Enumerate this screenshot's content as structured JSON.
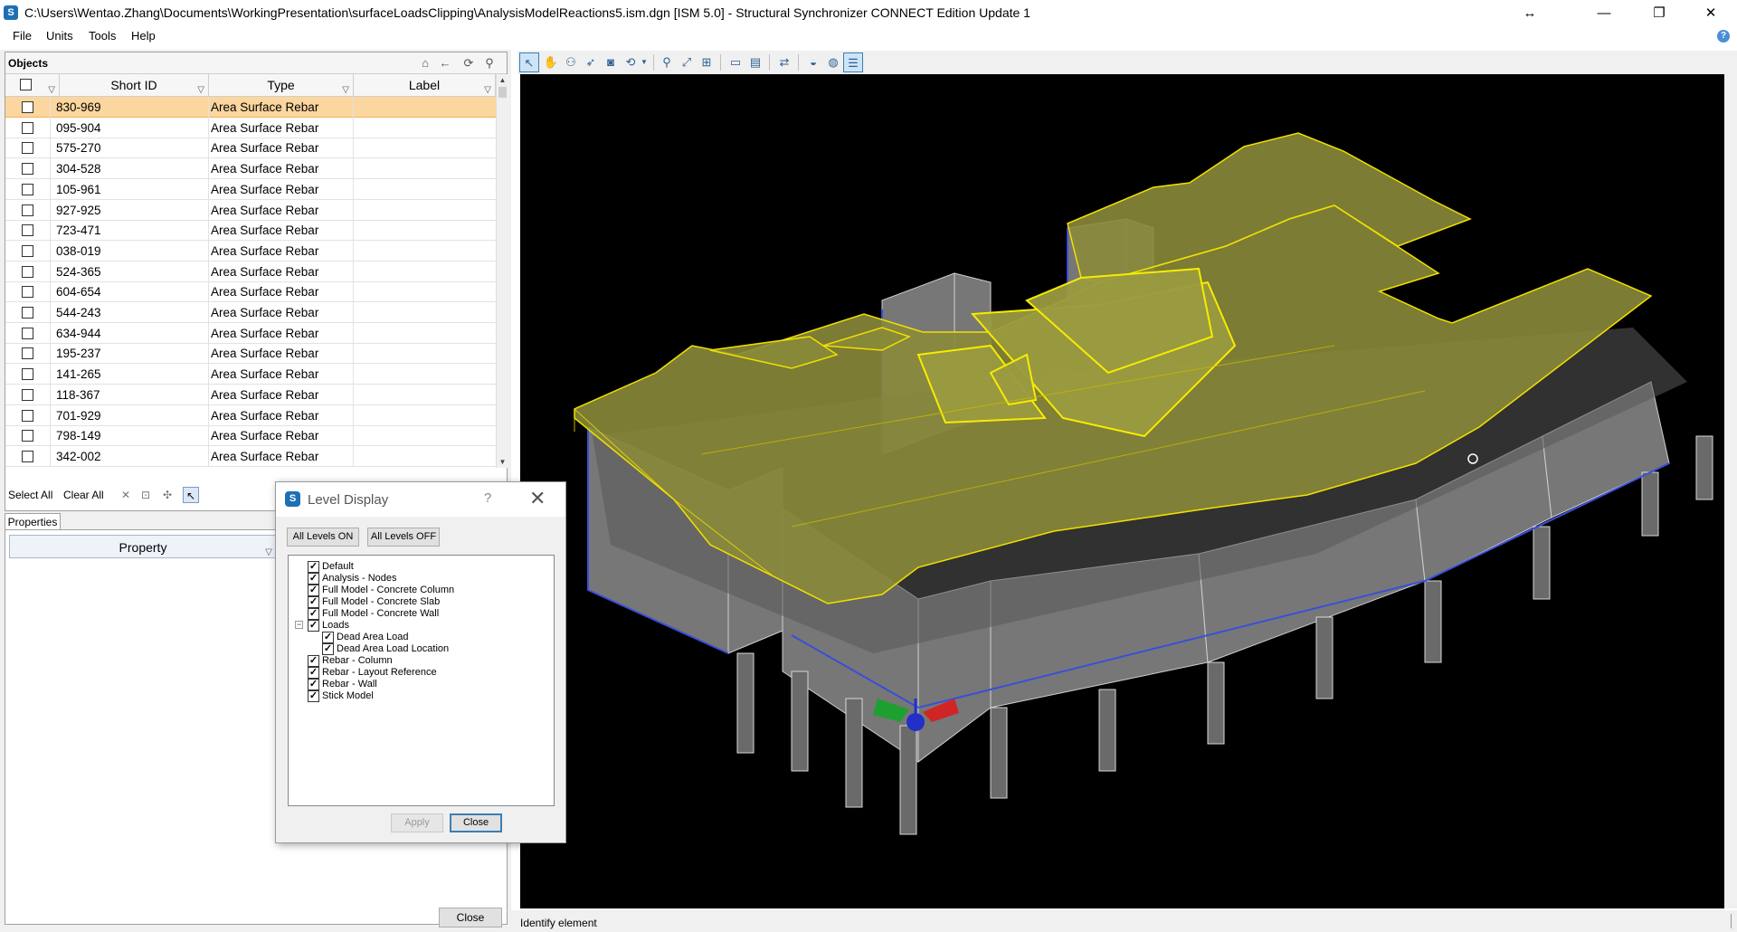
{
  "window": {
    "title": "C:\\Users\\Wentao.Zhang\\Documents\\WorkingPresentation\\surfaceLoadsClipping\\AnalysisModelReactions5.ism.dgn [ISM 5.0] - Structural Synchronizer CONNECT Edition Update 1",
    "icon": "S",
    "resize_glyph": "↔",
    "minimize_glyph": "—",
    "restore_glyph": "❐",
    "close_glyph": "✕"
  },
  "menu": {
    "file": "File",
    "units": "Units",
    "tools": "Tools",
    "help": "Help",
    "help_icon": "?"
  },
  "objects_panel": {
    "title": "Objects",
    "columns": {
      "short_id": "Short ID",
      "type": "Type",
      "label": "Label"
    },
    "rows": [
      {
        "id": "830-969",
        "type": "Area Surface Rebar",
        "label": ""
      },
      {
        "id": "095-904",
        "type": "Area Surface Rebar",
        "label": ""
      },
      {
        "id": "575-270",
        "type": "Area Surface Rebar",
        "label": ""
      },
      {
        "id": "304-528",
        "type": "Area Surface Rebar",
        "label": ""
      },
      {
        "id": "105-961",
        "type": "Area Surface Rebar",
        "label": ""
      },
      {
        "id": "927-925",
        "type": "Area Surface Rebar",
        "label": ""
      },
      {
        "id": "723-471",
        "type": "Area Surface Rebar",
        "label": ""
      },
      {
        "id": "038-019",
        "type": "Area Surface Rebar",
        "label": ""
      },
      {
        "id": "524-365",
        "type": "Area Surface Rebar",
        "label": ""
      },
      {
        "id": "604-654",
        "type": "Area Surface Rebar",
        "label": ""
      },
      {
        "id": "544-243",
        "type": "Area Surface Rebar",
        "label": ""
      },
      {
        "id": "634-944",
        "type": "Area Surface Rebar",
        "label": ""
      },
      {
        "id": "195-237",
        "type": "Area Surface Rebar",
        "label": ""
      },
      {
        "id": "141-265",
        "type": "Area Surface Rebar",
        "label": ""
      },
      {
        "id": "118-367",
        "type": "Area Surface Rebar",
        "label": ""
      },
      {
        "id": "701-929",
        "type": "Area Surface Rebar",
        "label": ""
      },
      {
        "id": "798-149",
        "type": "Area Surface Rebar",
        "label": ""
      },
      {
        "id": "342-002",
        "type": "Area Surface Rebar",
        "label": ""
      }
    ],
    "selected_row": 0,
    "select_all": "Select All",
    "clear_all": "Clear All"
  },
  "properties_panel": {
    "tab": "Properties",
    "column": "Property"
  },
  "main_close": "Close",
  "status": {
    "text": "Identify element"
  },
  "level_dialog": {
    "title": "Level Display",
    "help": "?",
    "close_glyph": "✕",
    "all_on": "All Levels ON",
    "all_off": "All Levels OFF",
    "levels": [
      {
        "name": "Default",
        "checked": true,
        "indent": 0
      },
      {
        "name": "Analysis - Nodes",
        "checked": true,
        "indent": 0
      },
      {
        "name": "Full Model - Concrete Column",
        "checked": true,
        "indent": 0
      },
      {
        "name": "Full Model - Concrete Slab",
        "checked": true,
        "indent": 0
      },
      {
        "name": "Full Model - Concrete Wall",
        "checked": true,
        "indent": 0
      },
      {
        "name": "Loads",
        "checked": true,
        "indent": 0
      },
      {
        "name": "Dead Area Load",
        "checked": true,
        "indent": 1
      },
      {
        "name": "Dead Area Load Location",
        "checked": true,
        "indent": 1
      },
      {
        "name": "Rebar - Column",
        "checked": true,
        "indent": 0
      },
      {
        "name": "Rebar - Layout Reference",
        "checked": true,
        "indent": 0
      },
      {
        "name": "Rebar - Wall",
        "checked": true,
        "indent": 0
      },
      {
        "name": "Stick Model",
        "checked": true,
        "indent": 0
      }
    ],
    "apply": "Apply",
    "close": "Close"
  },
  "colors": {
    "selection": "#fbd69e",
    "slab_fill": "#8a8a3a",
    "slab_edge": "#f0e000",
    "wall": "#7a7a7a",
    "viewport_bg": "#000000"
  }
}
